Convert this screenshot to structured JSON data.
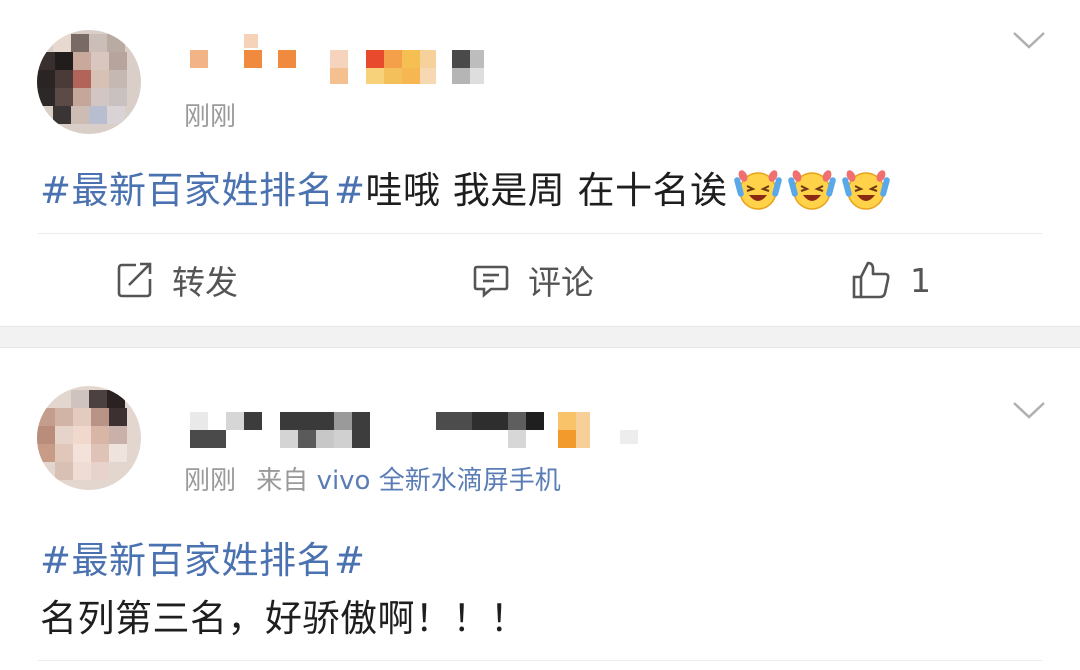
{
  "post1": {
    "time": "刚刚",
    "topic": "#最新百家姓排名#",
    "text": "哇哦 我是周 在十名诶",
    "emoji_icon": "laugh-cry-emoji",
    "emoji_count": 3,
    "actions": {
      "repost_label": "转发",
      "comment_label": "评论",
      "like_count": "1"
    }
  },
  "post2": {
    "time": "刚刚",
    "source_prefix": "来自",
    "source": "vivo 全新水滴屏手机",
    "topic": "#最新百家姓排名#",
    "text": "名列第三名，好骄傲啊！！！"
  },
  "colors": {
    "topic_link": "#4b72b0",
    "meta_gray": "#9a9a9a",
    "divider": "#ececec",
    "section_gap": "#f2f2f2"
  }
}
